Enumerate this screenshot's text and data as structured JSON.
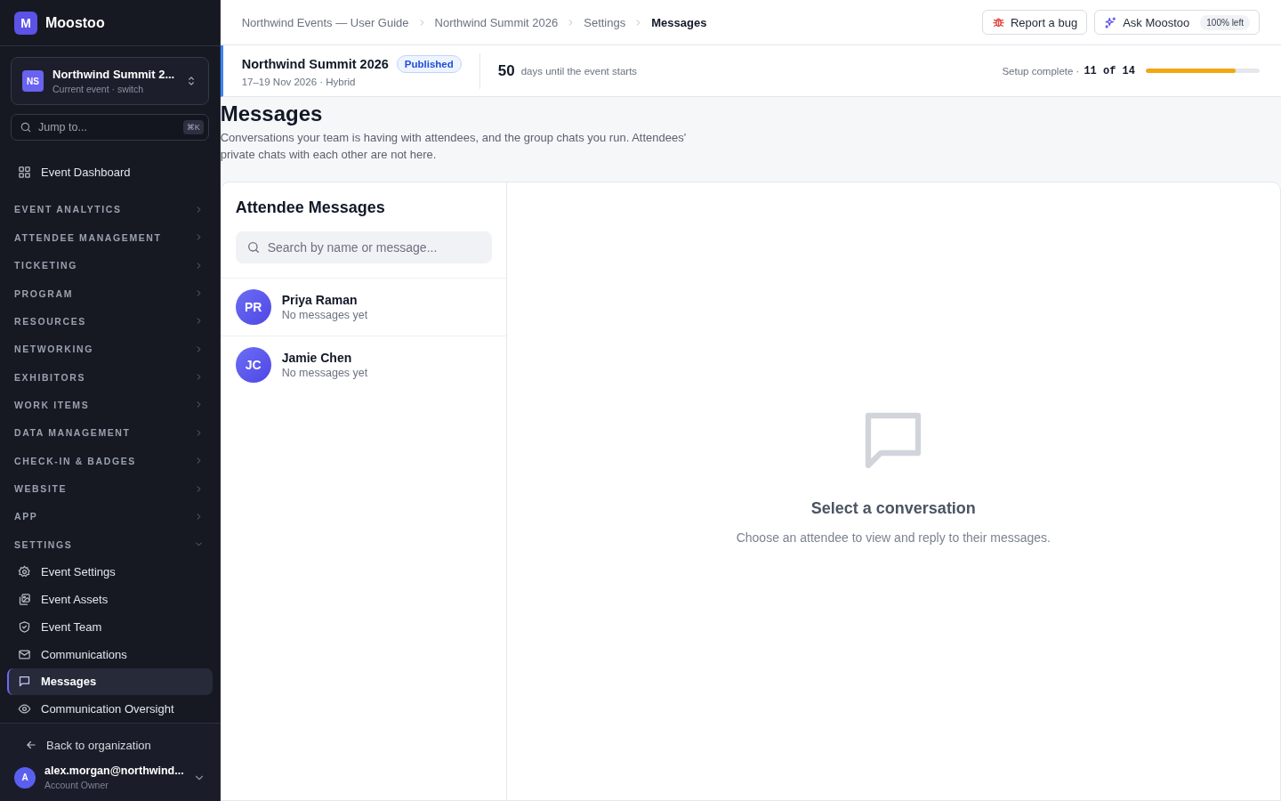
{
  "app": {
    "logo_letter": "M",
    "name": "Moostoo"
  },
  "event_switcher": {
    "initials": "NS",
    "name": "Northwind Summit 2...",
    "subtitle": "Current event · switch"
  },
  "jump": {
    "placeholder": "Jump to...",
    "shortcut": "⌘K"
  },
  "sidebar": {
    "items": [
      {
        "kind": "link",
        "label": "Event Dashboard",
        "selected": false
      },
      {
        "kind": "section",
        "label": "EVENT ANALYTICS",
        "expanded": false
      },
      {
        "kind": "section",
        "label": "ATTENDEE MANAGEMENT",
        "expanded": false
      },
      {
        "kind": "section",
        "label": "TICKETING",
        "expanded": false
      },
      {
        "kind": "section",
        "label": "PROGRAM",
        "expanded": false
      },
      {
        "kind": "section",
        "label": "RESOURCES",
        "expanded": false
      },
      {
        "kind": "section",
        "label": "NETWORKING",
        "expanded": false
      },
      {
        "kind": "section",
        "label": "EXHIBITORS",
        "expanded": false
      },
      {
        "kind": "section",
        "label": "WORK ITEMS",
        "expanded": false
      },
      {
        "kind": "section",
        "label": "DATA MANAGEMENT",
        "expanded": false
      },
      {
        "kind": "section",
        "label": "CHECK-IN & BADGES",
        "expanded": false
      },
      {
        "kind": "section",
        "label": "WEBSITE",
        "expanded": false
      },
      {
        "kind": "section",
        "label": "APP",
        "expanded": false
      },
      {
        "kind": "section",
        "label": "SETTINGS",
        "expanded": true,
        "children": [
          {
            "label": "Event Settings",
            "selected": false
          },
          {
            "label": "Event Assets",
            "selected": false
          },
          {
            "label": "Event Team",
            "selected": false
          },
          {
            "label": "Communications",
            "selected": false
          },
          {
            "label": "Messages",
            "selected": true
          },
          {
            "label": "Communication Oversight",
            "selected": false
          }
        ]
      }
    ]
  },
  "sidebar_footer": {
    "back_link": "Back to organization",
    "user": {
      "initial": "A",
      "email": "alex.morgan@northwind...",
      "role": "Account Owner"
    }
  },
  "breadcrumbs": [
    {
      "label": "Northwind Events — User Guide",
      "selected": false
    },
    {
      "label": "Northwind Summit 2026",
      "selected": false
    },
    {
      "label": "Settings",
      "selected": false
    },
    {
      "label": "Messages",
      "selected": true
    }
  ],
  "top_actions": {
    "report_bug": "Report a bug",
    "ask": "Ask Moostoo",
    "ask_badge": "100% left"
  },
  "event_header": {
    "name": "Northwind Summit 2026",
    "status": "Published",
    "dates": "17–19 Nov 2026 · Hybrid",
    "days": "50",
    "days_label": "days until the event starts",
    "setup_label": "Setup complete ·",
    "setup_count": "11 of 14",
    "setup_progress": {
      "level": 0.79
    }
  },
  "page": {
    "title": "Messages",
    "description": "Conversations your team is having with attendees, and the group chats you run. Attendees' private chats with each other are not here."
  },
  "conversations": {
    "title": "Attendee Messages",
    "search_placeholder": "Search by name or message...",
    "items": [
      {
        "initials": "PR",
        "name": "Priya Raman",
        "preview": "No messages yet",
        "selected": false
      },
      {
        "initials": "JC",
        "name": "Jamie Chen",
        "preview": "No messages yet",
        "selected": false
      }
    ]
  },
  "empty_state": {
    "title": "Select a conversation",
    "text": "Choose an attendee to view and reply to their messages."
  }
}
